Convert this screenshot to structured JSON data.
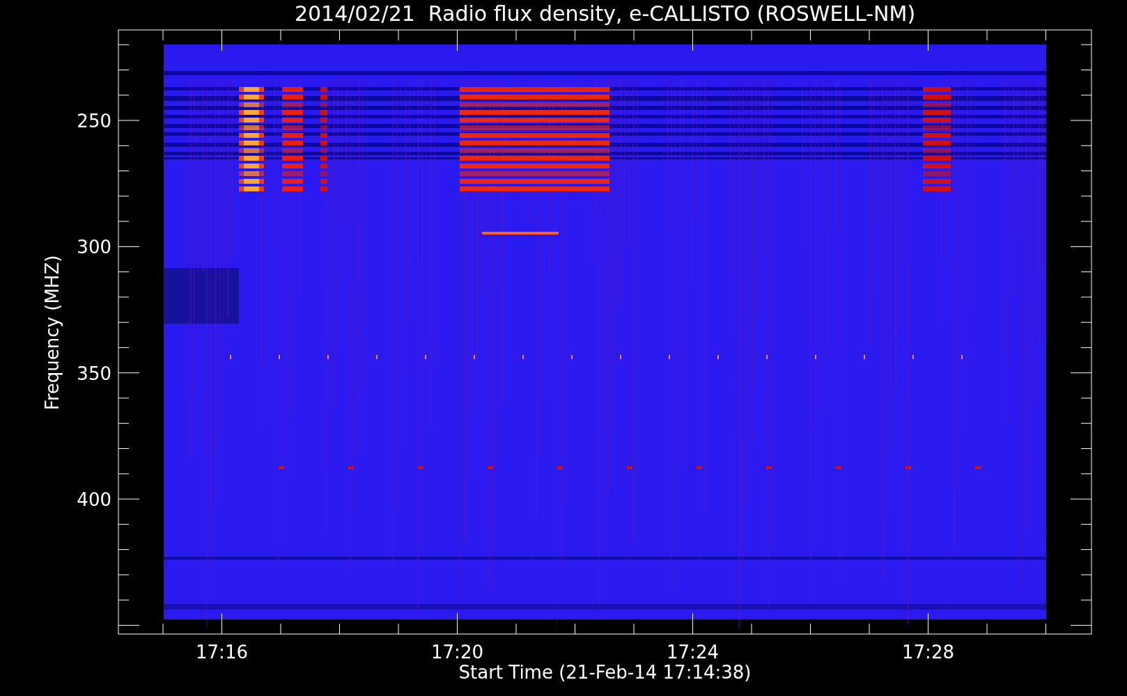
{
  "title": "2014/02/21  Radio flux density, e-CALLISTO (ROSWELL-NM)",
  "y_axis": {
    "label": "Frequency (MHZ)",
    "ticks": [
      "250",
      "300",
      "350",
      "400"
    ]
  },
  "x_axis": {
    "label": "Start Time (21-Feb-14 17:14:38)",
    "ticks": [
      "17:16",
      "17:20",
      "17:24",
      "17:28"
    ]
  }
}
